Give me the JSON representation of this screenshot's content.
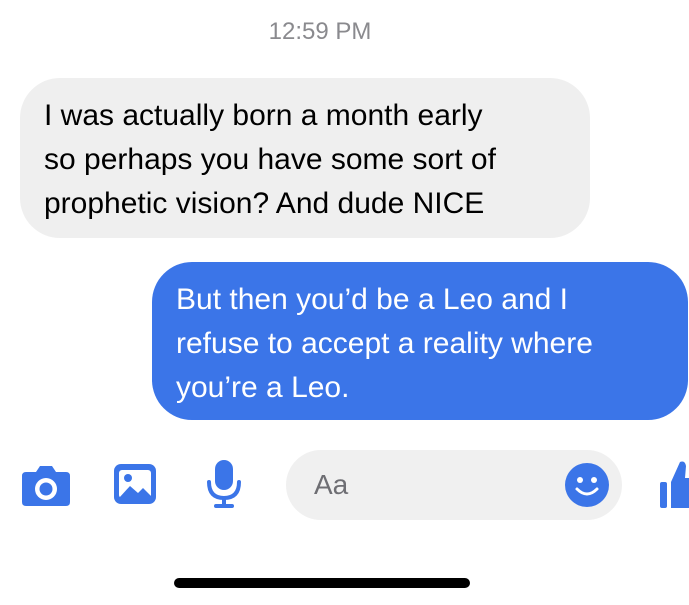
{
  "thread": {
    "timestamp": "12:59 PM",
    "messages": [
      {
        "direction": "incoming",
        "lines": [
          "I was actually born a month early",
          "so perhaps you have some sort of",
          "prophetic vision? And dude NICE"
        ]
      },
      {
        "direction": "outgoing",
        "lines": [
          "But then you’d be a Leo and I",
          "refuse to accept a reality where",
          "you’re a Leo."
        ]
      }
    ]
  },
  "composer": {
    "placeholder": "Aa",
    "icons": {
      "camera": "camera-icon",
      "gallery": "gallery-icon",
      "microphone": "microphone-icon",
      "emoji": "emoji-icon",
      "like": "thumbs-up-icon"
    }
  },
  "colors": {
    "accent": "#3b75e8",
    "incoming_bubble": "#efefef",
    "timestamp_text": "#8a8a8e",
    "composer_bg": "#f0f0f0"
  }
}
